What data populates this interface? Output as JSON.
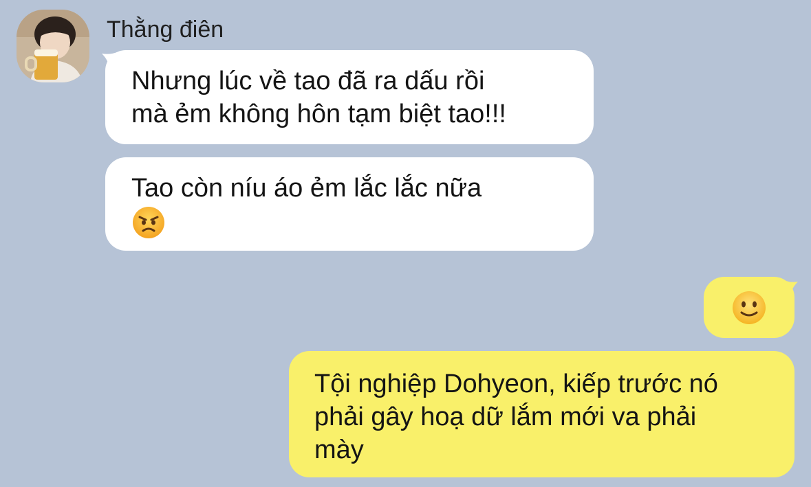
{
  "contact": {
    "name": "Thằng điên",
    "avatar_icon": "avatar-photo"
  },
  "messages": [
    {
      "direction": "incoming",
      "lines": [
        "Nhưng lúc về tao đã ra dấu rồi",
        "mà ẻm không hôn tạm biệt tao!!!"
      ]
    },
    {
      "direction": "incoming",
      "lines": [
        "Tao còn níu áo ẻm lắc lắc nữa"
      ],
      "emoji": "angry-face-emoji"
    },
    {
      "direction": "outgoing",
      "emoji": "slightly-smiling-face-emoji"
    },
    {
      "direction": "outgoing",
      "lines": [
        "Tội nghiệp Dohyeon, kiếp trước nó",
        "phải gây hoạ dữ lắm mới va phải",
        "mày"
      ]
    }
  ],
  "colors": {
    "background": "#b6c3d6",
    "incoming_bubble": "#ffffff",
    "outgoing_bubble": "#f9f06a"
  }
}
